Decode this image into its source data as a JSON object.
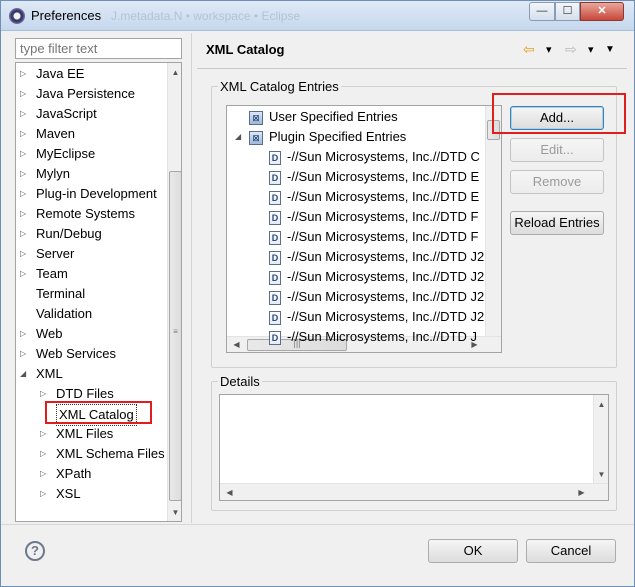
{
  "window": {
    "title": "Preferences",
    "ghost_title": "J.metadata.N • workspace • Eclipse",
    "minimize": "—",
    "maximize": "☐",
    "close": "✕"
  },
  "filter": {
    "placeholder": "type filter text"
  },
  "left_tree": [
    {
      "label": "Java EE",
      "level": 0,
      "arrow": "▷"
    },
    {
      "label": "Java Persistence",
      "level": 0,
      "arrow": "▷"
    },
    {
      "label": "JavaScript",
      "level": 0,
      "arrow": "▷"
    },
    {
      "label": "Maven",
      "level": 0,
      "arrow": "▷"
    },
    {
      "label": "MyEclipse",
      "level": 0,
      "arrow": "▷"
    },
    {
      "label": "Mylyn",
      "level": 0,
      "arrow": "▷"
    },
    {
      "label": "Plug-in Development",
      "level": 0,
      "arrow": "▷"
    },
    {
      "label": "Remote Systems",
      "level": 0,
      "arrow": "▷"
    },
    {
      "label": "Run/Debug",
      "level": 0,
      "arrow": "▷"
    },
    {
      "label": "Server",
      "level": 0,
      "arrow": "▷"
    },
    {
      "label": "Team",
      "level": 0,
      "arrow": "▷"
    },
    {
      "label": "Terminal",
      "level": 0,
      "arrow": ""
    },
    {
      "label": "Validation",
      "level": 0,
      "arrow": ""
    },
    {
      "label": "Web",
      "level": 0,
      "arrow": "▷"
    },
    {
      "label": "Web Services",
      "level": 0,
      "arrow": "▷"
    },
    {
      "label": "XML",
      "level": 0,
      "arrow": "◢"
    },
    {
      "label": "DTD Files",
      "level": 1,
      "arrow": "▷"
    },
    {
      "label": "XML Catalog",
      "level": 1,
      "arrow": "",
      "selected": true
    },
    {
      "label": "XML Files",
      "level": 1,
      "arrow": "▷"
    },
    {
      "label": "XML Schema Files",
      "level": 1,
      "arrow": "▷"
    },
    {
      "label": "XPath",
      "level": 1,
      "arrow": "▷"
    },
    {
      "label": "XSL",
      "level": 1,
      "arrow": "▷"
    }
  ],
  "page": {
    "title": "XML Catalog",
    "back_icon": "⇦",
    "forward_icon": "⇨",
    "menu_icon": "▼",
    "dropdown_icon": "▾"
  },
  "catalog_group": {
    "label": "XML Catalog Entries"
  },
  "catalog_entries": [
    {
      "label": "User Specified Entries",
      "icon": "cat",
      "arrow": ""
    },
    {
      "label": "Plugin Specified Entries",
      "icon": "cat",
      "arrow": "◢"
    },
    {
      "label": "-//Sun Microsystems, Inc.//DTD C",
      "icon": "D"
    },
    {
      "label": "-//Sun Microsystems, Inc.//DTD E",
      "icon": "D"
    },
    {
      "label": "-//Sun Microsystems, Inc.//DTD E",
      "icon": "D"
    },
    {
      "label": "-//Sun Microsystems, Inc.//DTD F",
      "icon": "D"
    },
    {
      "label": "-//Sun Microsystems, Inc.//DTD F",
      "icon": "D"
    },
    {
      "label": "-//Sun Microsystems, Inc.//DTD J2",
      "icon": "D"
    },
    {
      "label": "-//Sun Microsystems, Inc.//DTD J2",
      "icon": "D"
    },
    {
      "label": "-//Sun Microsystems, Inc.//DTD J2",
      "icon": "D"
    },
    {
      "label": "-//Sun Microsystems, Inc.//DTD J2",
      "icon": "D"
    },
    {
      "label": "-//Sun Microsystems, Inc.//DTD J",
      "icon": "D"
    }
  ],
  "buttons": {
    "add": "Add...",
    "edit": "Edit...",
    "remove": "Remove",
    "reload": "Reload Entries",
    "ok": "OK",
    "cancel": "Cancel"
  },
  "details": {
    "label": "Details"
  },
  "help": {
    "icon": "?"
  },
  "colors": {
    "highlight": "#e01e1e",
    "nav_arrow": "#e0a020"
  }
}
